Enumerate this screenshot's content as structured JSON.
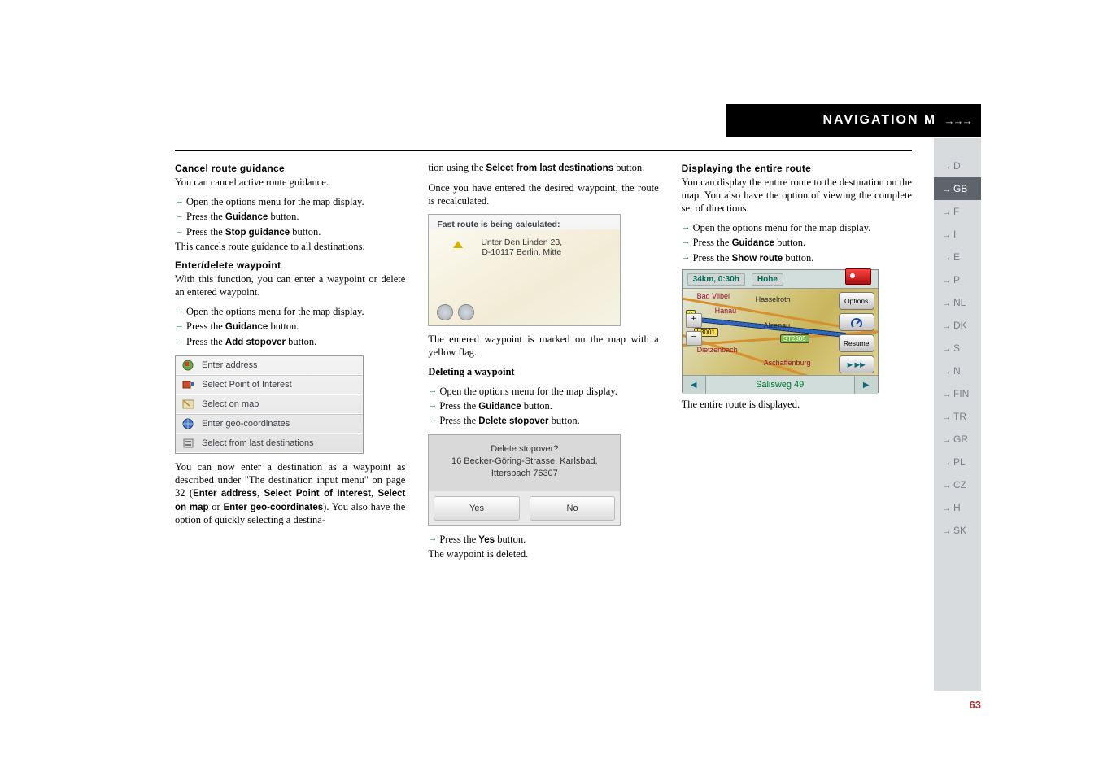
{
  "header": {
    "title": "NAVIGATION MODE",
    "arrows": "→→→"
  },
  "langs": [
    "D",
    "GB",
    "F",
    "I",
    "E",
    "P",
    "NL",
    "DK",
    "S",
    "N",
    "FIN",
    "TR",
    "GR",
    "PL",
    "CZ",
    "H",
    "SK"
  ],
  "active_lang": "GB",
  "page_number": "63",
  "col1": {
    "h1": "Cancel route guidance",
    "p1": "You can cancel active route guidance.",
    "a1": "Open the options menu for the map display.",
    "a2": "Press the ",
    "a2b": "Guidance",
    "a2end": " button.",
    "a3": "Press the ",
    "a3b": "Stop guidance",
    "a3end": " button.",
    "p2": "This cancels route guidance to all destinations.",
    "h2": "Enter/delete waypoint",
    "p3": "With this function, you can enter a waypoint or delete an entered waypoint.",
    "b1": "Open the options menu for the map display.",
    "b2": "Press the ",
    "b2b": "Guidance",
    "b2end": " button.",
    "b3": "Press the ",
    "b3b": "Add stopover",
    "b3end": " button.",
    "list": [
      "Enter address",
      "Select Point of Interest",
      "Select on map",
      "Enter geo-coordinates",
      "Select from last destinations"
    ],
    "p4a": "You can now enter a destination as a waypoint as described under \"The destination input menu\" on page 32 (",
    "p4b1": "Enter address",
    "p4c": ", ",
    "p4b2": "Select Point of Interest",
    "p4d": ", ",
    "p4b3": "Select on map",
    "p4e": " or ",
    "p4b4": "Enter geo-coordinates",
    "p4f": "). You also have the option of quickly selecting a destina-"
  },
  "col2": {
    "p1a": "tion using the ",
    "p1b": "Select from last destinations",
    "p1c": " button.",
    "p2": "Once you have entered the desired waypoint, the route is recalculated.",
    "calc_head": "Fast route is being calculated:",
    "calc_addr_l1": "Unter Den Linden 23,",
    "calc_addr_l2": "D-10117 Berlin, Mitte",
    "p3": "The entered waypoint is marked on the map with a yellow flag.",
    "h3": "Deleting a waypoint",
    "c1": "Open the options menu for the map display.",
    "c2": "Press the ",
    "c2b": "Guidance",
    "c2end": " button.",
    "c3": "Press the ",
    "c3b": "Delete stopover",
    "c3end": " button.",
    "stop_q": "Delete stopover?",
    "stop_l1": "16 Becker-Göring-Strasse, Karlsbad,",
    "stop_l2": "Ittersbach 76307",
    "yes": "Yes",
    "no": "No",
    "d1": "Press the ",
    "d1b": "Yes",
    "d1end": " button.",
    "p4": "The waypoint is deleted."
  },
  "col3": {
    "h1": "Displaying the entire route",
    "p1": "You can display the entire route to the destination on the map. You also have the option of viewing the complete set of directions.",
    "a1": "Open the options menu for the map display.",
    "a2": "Press the ",
    "a2b": "Guidance",
    "a2end": " button.",
    "a3": "Press the ",
    "a3b": "Show route",
    "a3end": " button.",
    "map_top": "34km, 0:30h",
    "map_top2": "Hohe",
    "opt_label": "Options",
    "resume_label": "Resume",
    "cities": {
      "badvilbel": "Bad Vilbel",
      "hanau": "Hanau",
      "alzenau": "Alzenau",
      "dietz": "Dietzenbach",
      "aschaf": "Aschaffenburg",
      "hasselroth": "Hasselroth"
    },
    "signs": {
      "l3001": "L3001",
      "st2305": "ST2305",
      "r3": "3"
    },
    "route_street": "Salisweg 49",
    "p2": "The entire route is displayed."
  }
}
